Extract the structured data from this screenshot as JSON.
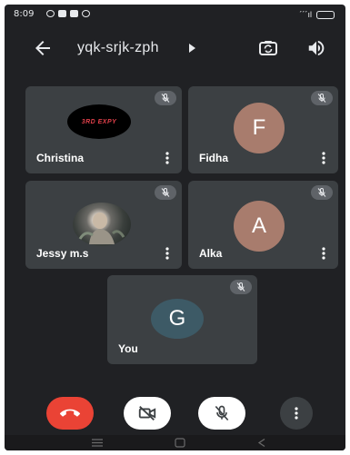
{
  "status_bar": {
    "time": "8:09",
    "signal_text": "´´´ıl"
  },
  "app_bar": {
    "meeting_code": "yqk-srjk-zph"
  },
  "participants": [
    {
      "name": "Christina",
      "avatar_type": "photo",
      "avatar_caption": "3RD EXPY",
      "muted": true
    },
    {
      "name": "Fidha",
      "avatar_type": "letter",
      "avatar_letter": "F",
      "avatar_color": "#a87c6d",
      "muted": true
    },
    {
      "name": "Jessy m.s",
      "avatar_type": "photo",
      "muted": true
    },
    {
      "name": "Alka",
      "avatar_type": "letter",
      "avatar_letter": "A",
      "avatar_color": "#a87c6d",
      "muted": true
    },
    {
      "name": "You",
      "avatar_type": "letter",
      "avatar_letter": "G",
      "avatar_color": "#3d5a66",
      "muted": true
    }
  ],
  "controls": {
    "end_call_color": "#ea4335",
    "camera": "off",
    "microphone": "off"
  },
  "colors": {
    "background": "#202124",
    "tile": "#3c4043",
    "end_call": "#ea4335"
  }
}
